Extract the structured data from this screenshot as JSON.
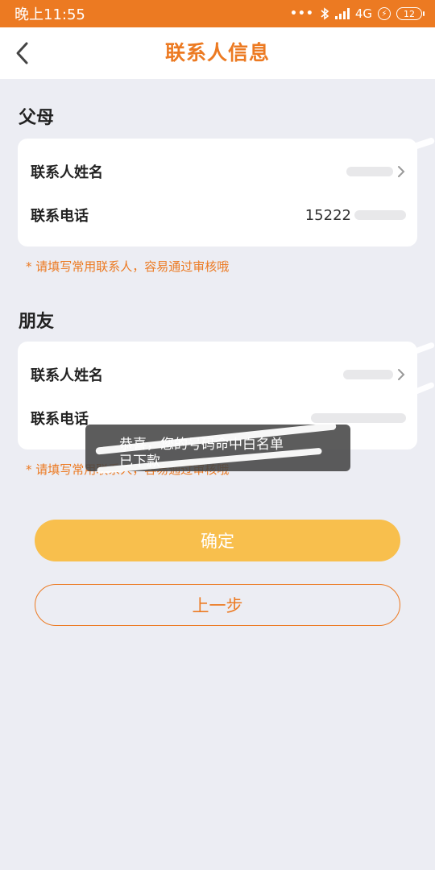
{
  "status_bar": {
    "time": "晚上11:55",
    "network": "4G",
    "battery": "12"
  },
  "header": {
    "title": "联系人信息"
  },
  "sections": [
    {
      "title": "父母",
      "rows": [
        {
          "label": "联系人姓名",
          "value": ""
        },
        {
          "label": "联系电话",
          "value": "15222"
        }
      ],
      "hint": "* 请填写常用联系人，容易通过审核哦"
    },
    {
      "title": "朋友",
      "rows": [
        {
          "label": "联系人姓名",
          "value": ""
        },
        {
          "label": "联系电话",
          "value": ""
        }
      ],
      "hint": "* 请填写常用联系人，容易通过审核哦"
    }
  ],
  "toast": {
    "line1": "恭喜，您的号码命中白名单",
    "line2": "已下款"
  },
  "buttons": {
    "confirm": "确定",
    "previous": "上一步"
  },
  "colors": {
    "accent": "#ec7a22",
    "confirm_button": "#f8bf4d",
    "background": "#ecedf3"
  }
}
